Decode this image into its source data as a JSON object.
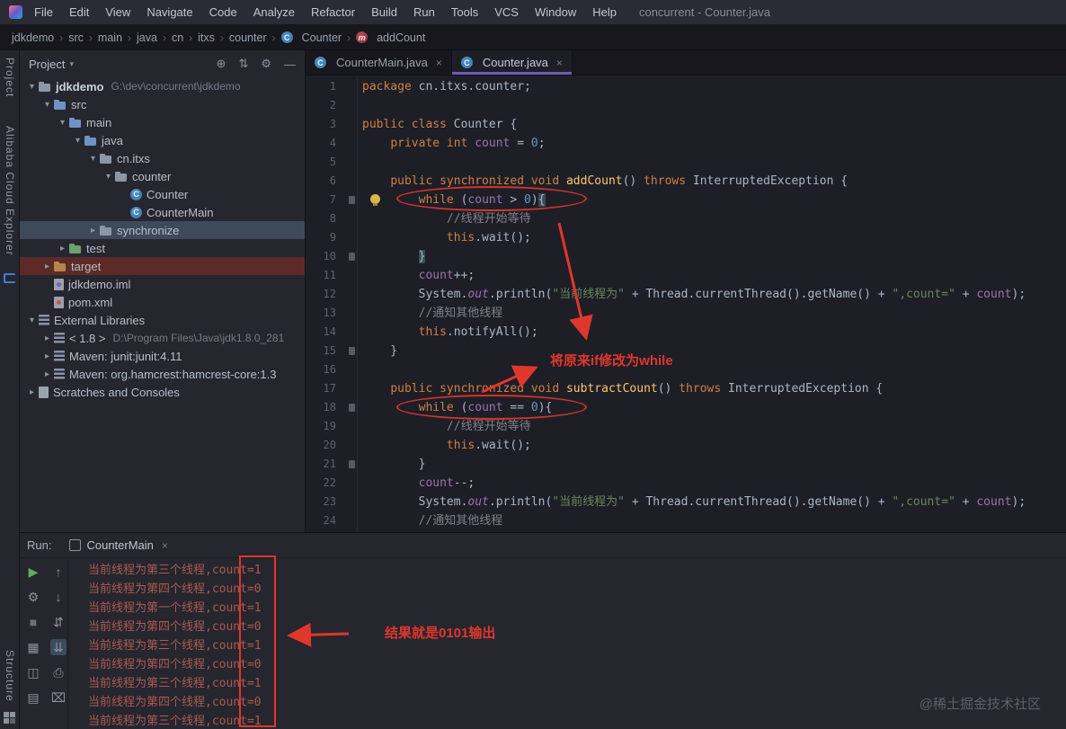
{
  "window_title": "concurrent - Counter.java",
  "glyphs": {
    "close": "×",
    "caret_down": "▾",
    "crumb_sep": "›",
    "tree_down": "▾",
    "tree_right": "▸"
  },
  "menu": {
    "items": [
      "File",
      "Edit",
      "View",
      "Navigate",
      "Code",
      "Analyze",
      "Refactor",
      "Build",
      "Run",
      "Tools",
      "VCS",
      "Window",
      "Help"
    ]
  },
  "breadcrumbs": [
    {
      "label": "jdkdemo"
    },
    {
      "label": "src"
    },
    {
      "label": "main"
    },
    {
      "label": "java"
    },
    {
      "label": "cn"
    },
    {
      "label": "itxs"
    },
    {
      "label": "counter"
    },
    {
      "label": "Counter",
      "icon": "class"
    },
    {
      "label": "addCount",
      "icon": "method"
    }
  ],
  "tool_stripe": {
    "project": "Project",
    "alibaba": "Alibaba Cloud Explorer",
    "structure": "Structure"
  },
  "project_panel": {
    "header": "Project",
    "header_icons": [
      {
        "name": "locate-icon",
        "glyph": "⊕"
      },
      {
        "name": "collapse-all-icon",
        "glyph": "⇅"
      },
      {
        "name": "settings-gear-icon",
        "glyph": "⚙"
      },
      {
        "name": "hide-panel-icon",
        "glyph": "—"
      }
    ],
    "tree": [
      {
        "label": "jdkdemo",
        "hint": "G:\\dev\\concurrent\\jdkdemo",
        "indent": 0,
        "chevron": "down",
        "icon": "folder",
        "bold": true
      },
      {
        "label": "src",
        "indent": 1,
        "chevron": "down",
        "icon": "folder-src"
      },
      {
        "label": "main",
        "indent": 2,
        "chevron": "down",
        "icon": "folder-src"
      },
      {
        "label": "java",
        "indent": 3,
        "chevron": "down",
        "icon": "folder-src"
      },
      {
        "label": "cn.itxs",
        "indent": 4,
        "chevron": "down",
        "icon": "package"
      },
      {
        "label": "counter",
        "indent": 5,
        "chevron": "down",
        "icon": "package"
      },
      {
        "label": "Counter",
        "indent": 6,
        "chevron": "none",
        "icon": "class"
      },
      {
        "label": "CounterMain",
        "indent": 6,
        "chevron": "none",
        "icon": "class"
      },
      {
        "label": "synchronize",
        "indent": 4,
        "chevron": "right",
        "icon": "package",
        "sel": "gray"
      },
      {
        "label": "test",
        "indent": 2,
        "chevron": "right",
        "icon": "folder-green"
      },
      {
        "label": "target",
        "indent": 1,
        "chevron": "right",
        "icon": "folder-orange",
        "sel": "red"
      },
      {
        "label": "jdkdemo.iml",
        "indent": 1,
        "chevron": "none",
        "icon": "file-iml"
      },
      {
        "label": "pom.xml",
        "indent": 1,
        "chevron": "none",
        "icon": "file-maven"
      },
      {
        "label": "External Libraries",
        "indent": 0,
        "chevron": "down",
        "icon": "lib"
      },
      {
        "label": "< 1.8 >",
        "hint": "D:\\Program Files\\Java\\jdk1.8.0_281",
        "indent": 1,
        "chevron": "right",
        "icon": "lib"
      },
      {
        "label": "Maven: junit:junit:4.11",
        "indent": 1,
        "chevron": "right",
        "icon": "lib"
      },
      {
        "label": "Maven: org.hamcrest:hamcrest-core:1.3",
        "indent": 1,
        "chevron": "right",
        "icon": "lib"
      },
      {
        "label": "Scratches and Consoles",
        "indent": 0,
        "chevron": "right",
        "icon": "scratch"
      }
    ]
  },
  "editor": {
    "tabs": [
      {
        "label": "CounterMain.java",
        "active": false
      },
      {
        "label": "Counter.java",
        "active": true
      }
    ],
    "lines": [
      {
        "n": 1,
        "t": [
          [
            "kw",
            "package"
          ],
          [
            "pl",
            " cn.itxs.counter;"
          ]
        ]
      },
      {
        "n": 2,
        "t": []
      },
      {
        "n": 3,
        "t": [
          [
            "kw",
            "public class"
          ],
          [
            "pl",
            " Counter {"
          ]
        ]
      },
      {
        "n": 4,
        "t": [
          [
            "pl",
            "    "
          ],
          [
            "kw",
            "private int"
          ],
          [
            "pl",
            " "
          ],
          [
            "fld",
            "count"
          ],
          [
            "pl",
            " = "
          ],
          [
            "num",
            "0"
          ],
          [
            "pl",
            ";"
          ]
        ]
      },
      {
        "n": 5,
        "t": []
      },
      {
        "n": 6,
        "t": [
          [
            "pl",
            "    "
          ],
          [
            "kw",
            "public synchronized void"
          ],
          [
            "pl",
            " "
          ],
          [
            "fn",
            "addCount"
          ],
          [
            "pl",
            "() "
          ],
          [
            "kw",
            "throws"
          ],
          [
            "pl",
            " InterruptedException {"
          ]
        ]
      },
      {
        "n": 7,
        "bulb": true,
        "mark": true,
        "t": [
          [
            "pl",
            "        "
          ],
          [
            "kw",
            "while"
          ],
          [
            "pl",
            " ("
          ],
          [
            "fld",
            "count"
          ],
          [
            "pl",
            " > "
          ],
          [
            "num",
            "0"
          ],
          [
            "pl",
            ")"
          ],
          [
            "pl hl",
            "{"
          ]
        ]
      },
      {
        "n": 8,
        "t": [
          [
            "pl",
            "            "
          ],
          [
            "cmt",
            "//线程开始等待"
          ]
        ]
      },
      {
        "n": 9,
        "t": [
          [
            "pl",
            "            "
          ],
          [
            "kw",
            "this"
          ],
          [
            "pl",
            ".wait();"
          ]
        ]
      },
      {
        "n": 10,
        "mark": true,
        "t": [
          [
            "pl",
            "        "
          ],
          [
            "pl hl",
            "}"
          ]
        ]
      },
      {
        "n": 11,
        "t": [
          [
            "pl",
            "        "
          ],
          [
            "fld",
            "count"
          ],
          [
            "pl",
            "++;"
          ]
        ]
      },
      {
        "n": 12,
        "t": [
          [
            "pl",
            "        System."
          ],
          [
            "out",
            "out"
          ],
          [
            "pl",
            ".println("
          ],
          [
            "str",
            "\"当前线程为\""
          ],
          [
            "pl",
            " + Thread.currentThread().getName() + "
          ],
          [
            "str",
            "\",count=\""
          ],
          [
            "pl",
            " + "
          ],
          [
            "fld",
            "count"
          ],
          [
            "pl",
            ");"
          ]
        ]
      },
      {
        "n": 13,
        "t": [
          [
            "pl",
            "        "
          ],
          [
            "cmt",
            "//通知其他线程"
          ]
        ]
      },
      {
        "n": 14,
        "t": [
          [
            "pl",
            "        "
          ],
          [
            "kw",
            "this"
          ],
          [
            "pl",
            ".notifyAll();"
          ]
        ]
      },
      {
        "n": 15,
        "mark": true,
        "t": [
          [
            "pl",
            "    }"
          ]
        ]
      },
      {
        "n": 16,
        "t": []
      },
      {
        "n": 17,
        "t": [
          [
            "pl",
            "    "
          ],
          [
            "kw",
            "public synchronized void"
          ],
          [
            "pl",
            " "
          ],
          [
            "fn",
            "subtractCount"
          ],
          [
            "pl",
            "() "
          ],
          [
            "kw",
            "throws"
          ],
          [
            "pl",
            " InterruptedException {"
          ]
        ]
      },
      {
        "n": 18,
        "mark": true,
        "t": [
          [
            "pl",
            "        "
          ],
          [
            "kw",
            "while"
          ],
          [
            "pl",
            " ("
          ],
          [
            "fld",
            "count"
          ],
          [
            "pl",
            " == "
          ],
          [
            "num",
            "0"
          ],
          [
            "pl",
            "){"
          ]
        ]
      },
      {
        "n": 19,
        "t": [
          [
            "pl",
            "            "
          ],
          [
            "cmt",
            "//线程开始等待"
          ]
        ]
      },
      {
        "n": 20,
        "t": [
          [
            "pl",
            "            "
          ],
          [
            "kw",
            "this"
          ],
          [
            "pl",
            ".wait();"
          ]
        ]
      },
      {
        "n": 21,
        "mark": true,
        "t": [
          [
            "pl",
            "        }"
          ]
        ]
      },
      {
        "n": 22,
        "t": [
          [
            "pl",
            "        "
          ],
          [
            "fld",
            "count"
          ],
          [
            "pl",
            "--;"
          ]
        ]
      },
      {
        "n": 23,
        "t": [
          [
            "pl",
            "        System."
          ],
          [
            "out",
            "out"
          ],
          [
            "pl",
            ".println("
          ],
          [
            "str",
            "\"当前线程为\""
          ],
          [
            "pl",
            " + Thread.currentThread().getName() + "
          ],
          [
            "str",
            "\",count=\""
          ],
          [
            "pl",
            " + "
          ],
          [
            "fld",
            "count"
          ],
          [
            "pl",
            ");"
          ]
        ]
      },
      {
        "n": 24,
        "t": [
          [
            "pl",
            "        "
          ],
          [
            "cmt",
            "//通知其他线程"
          ]
        ]
      }
    ]
  },
  "annotations": {
    "code_note": "将原来if修改为while",
    "console_note": "结果就是0101输出"
  },
  "run_panel": {
    "label": "Run:",
    "tab": "CounterMain",
    "toolbar_col1": [
      {
        "name": "rerun-button",
        "glyph": "▶",
        "color": "#5caf5c"
      },
      {
        "name": "customize-button",
        "glyph": "⚙"
      },
      {
        "name": "stop-button",
        "glyph": "■",
        "color": "#6b7078"
      },
      {
        "name": "dump-threads-button",
        "glyph": "▦"
      },
      {
        "name": "restore-layout-button",
        "glyph": "◫"
      },
      {
        "name": "layout-settings-button",
        "glyph": "▤"
      }
    ],
    "toolbar_col2": [
      {
        "name": "prev-occurrence-button",
        "glyph": "↑"
      },
      {
        "name": "next-occurrence-button",
        "glyph": "↓"
      },
      {
        "name": "soft-wrap-button",
        "glyph": "⇵"
      },
      {
        "name": "scroll-to-end-button",
        "glyph": "⇊",
        "active": true
      },
      {
        "name": "print-button",
        "glyph": "⎙"
      },
      {
        "name": "clear-all-button",
        "glyph": "⌧"
      }
    ],
    "console_lines": [
      "当前线程为第三个线程,count=1",
      "当前线程为第四个线程,count=0",
      "当前线程为第一个线程,count=1",
      "当前线程为第四个线程,count=0",
      "当前线程为第三个线程,count=1",
      "当前线程为第四个线程,count=0",
      "当前线程为第三个线程,count=1",
      "当前线程为第四个线程,count=0",
      "当前线程为第三个线程,count=1"
    ]
  },
  "watermark": "@稀土掘金技术社区"
}
